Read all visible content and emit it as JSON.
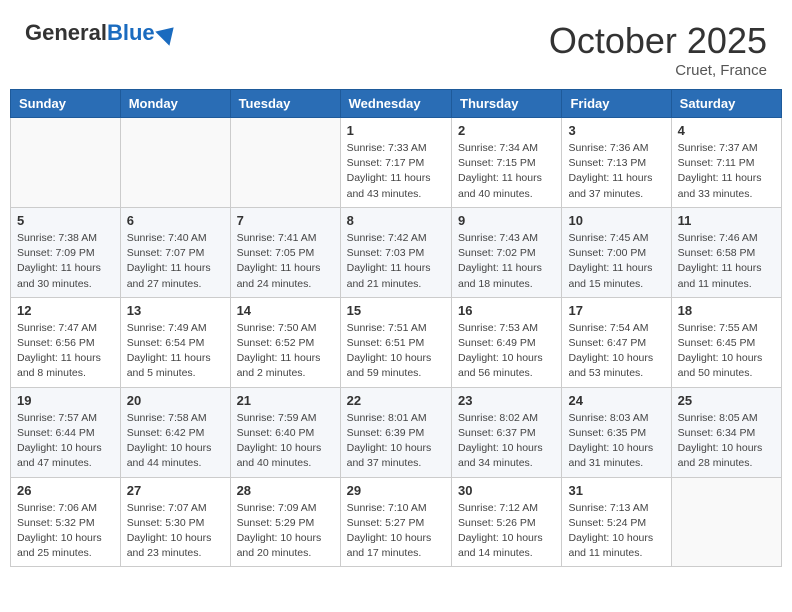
{
  "header": {
    "logo_general": "General",
    "logo_blue": "Blue",
    "month_title": "October 2025",
    "location": "Cruet, France"
  },
  "days_of_week": [
    "Sunday",
    "Monday",
    "Tuesday",
    "Wednesday",
    "Thursday",
    "Friday",
    "Saturday"
  ],
  "weeks": [
    [
      {
        "day": "",
        "info": ""
      },
      {
        "day": "",
        "info": ""
      },
      {
        "day": "",
        "info": ""
      },
      {
        "day": "1",
        "info": "Sunrise: 7:33 AM\nSunset: 7:17 PM\nDaylight: 11 hours\nand 43 minutes."
      },
      {
        "day": "2",
        "info": "Sunrise: 7:34 AM\nSunset: 7:15 PM\nDaylight: 11 hours\nand 40 minutes."
      },
      {
        "day": "3",
        "info": "Sunrise: 7:36 AM\nSunset: 7:13 PM\nDaylight: 11 hours\nand 37 minutes."
      },
      {
        "day": "4",
        "info": "Sunrise: 7:37 AM\nSunset: 7:11 PM\nDaylight: 11 hours\nand 33 minutes."
      }
    ],
    [
      {
        "day": "5",
        "info": "Sunrise: 7:38 AM\nSunset: 7:09 PM\nDaylight: 11 hours\nand 30 minutes."
      },
      {
        "day": "6",
        "info": "Sunrise: 7:40 AM\nSunset: 7:07 PM\nDaylight: 11 hours\nand 27 minutes."
      },
      {
        "day": "7",
        "info": "Sunrise: 7:41 AM\nSunset: 7:05 PM\nDaylight: 11 hours\nand 24 minutes."
      },
      {
        "day": "8",
        "info": "Sunrise: 7:42 AM\nSunset: 7:03 PM\nDaylight: 11 hours\nand 21 minutes."
      },
      {
        "day": "9",
        "info": "Sunrise: 7:43 AM\nSunset: 7:02 PM\nDaylight: 11 hours\nand 18 minutes."
      },
      {
        "day": "10",
        "info": "Sunrise: 7:45 AM\nSunset: 7:00 PM\nDaylight: 11 hours\nand 15 minutes."
      },
      {
        "day": "11",
        "info": "Sunrise: 7:46 AM\nSunset: 6:58 PM\nDaylight: 11 hours\nand 11 minutes."
      }
    ],
    [
      {
        "day": "12",
        "info": "Sunrise: 7:47 AM\nSunset: 6:56 PM\nDaylight: 11 hours\nand 8 minutes."
      },
      {
        "day": "13",
        "info": "Sunrise: 7:49 AM\nSunset: 6:54 PM\nDaylight: 11 hours\nand 5 minutes."
      },
      {
        "day": "14",
        "info": "Sunrise: 7:50 AM\nSunset: 6:52 PM\nDaylight: 11 hours\nand 2 minutes."
      },
      {
        "day": "15",
        "info": "Sunrise: 7:51 AM\nSunset: 6:51 PM\nDaylight: 10 hours\nand 59 minutes."
      },
      {
        "day": "16",
        "info": "Sunrise: 7:53 AM\nSunset: 6:49 PM\nDaylight: 10 hours\nand 56 minutes."
      },
      {
        "day": "17",
        "info": "Sunrise: 7:54 AM\nSunset: 6:47 PM\nDaylight: 10 hours\nand 53 minutes."
      },
      {
        "day": "18",
        "info": "Sunrise: 7:55 AM\nSunset: 6:45 PM\nDaylight: 10 hours\nand 50 minutes."
      }
    ],
    [
      {
        "day": "19",
        "info": "Sunrise: 7:57 AM\nSunset: 6:44 PM\nDaylight: 10 hours\nand 47 minutes."
      },
      {
        "day": "20",
        "info": "Sunrise: 7:58 AM\nSunset: 6:42 PM\nDaylight: 10 hours\nand 44 minutes."
      },
      {
        "day": "21",
        "info": "Sunrise: 7:59 AM\nSunset: 6:40 PM\nDaylight: 10 hours\nand 40 minutes."
      },
      {
        "day": "22",
        "info": "Sunrise: 8:01 AM\nSunset: 6:39 PM\nDaylight: 10 hours\nand 37 minutes."
      },
      {
        "day": "23",
        "info": "Sunrise: 8:02 AM\nSunset: 6:37 PM\nDaylight: 10 hours\nand 34 minutes."
      },
      {
        "day": "24",
        "info": "Sunrise: 8:03 AM\nSunset: 6:35 PM\nDaylight: 10 hours\nand 31 minutes."
      },
      {
        "day": "25",
        "info": "Sunrise: 8:05 AM\nSunset: 6:34 PM\nDaylight: 10 hours\nand 28 minutes."
      }
    ],
    [
      {
        "day": "26",
        "info": "Sunrise: 7:06 AM\nSunset: 5:32 PM\nDaylight: 10 hours\nand 25 minutes."
      },
      {
        "day": "27",
        "info": "Sunrise: 7:07 AM\nSunset: 5:30 PM\nDaylight: 10 hours\nand 23 minutes."
      },
      {
        "day": "28",
        "info": "Sunrise: 7:09 AM\nSunset: 5:29 PM\nDaylight: 10 hours\nand 20 minutes."
      },
      {
        "day": "29",
        "info": "Sunrise: 7:10 AM\nSunset: 5:27 PM\nDaylight: 10 hours\nand 17 minutes."
      },
      {
        "day": "30",
        "info": "Sunrise: 7:12 AM\nSunset: 5:26 PM\nDaylight: 10 hours\nand 14 minutes."
      },
      {
        "day": "31",
        "info": "Sunrise: 7:13 AM\nSunset: 5:24 PM\nDaylight: 10 hours\nand 11 minutes."
      },
      {
        "day": "",
        "info": ""
      }
    ]
  ]
}
